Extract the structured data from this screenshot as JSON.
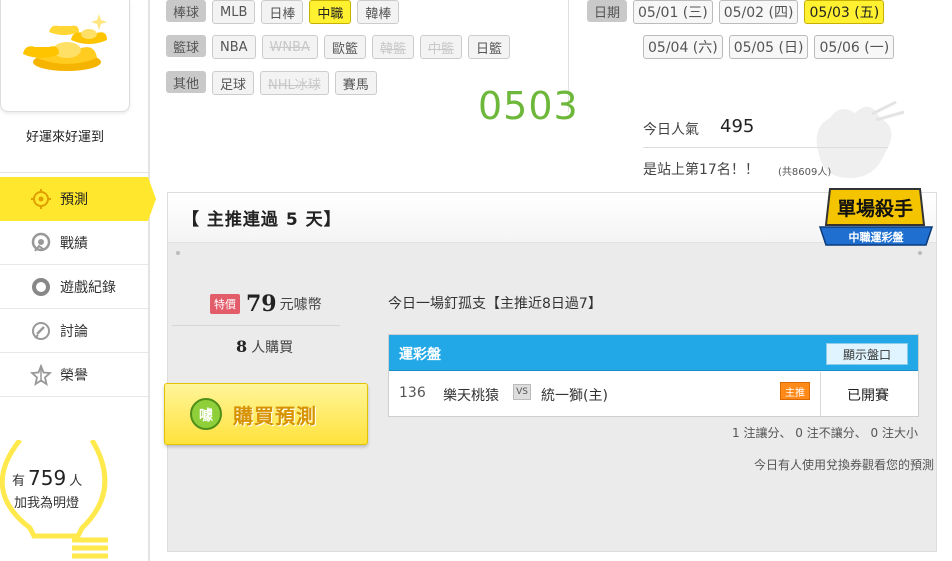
{
  "sidebar": {
    "user_name": "好運來好運到",
    "nav": [
      {
        "label": "預測",
        "icon": "target-icon",
        "active": true
      },
      {
        "label": "戰績",
        "icon": "chart-badge-icon",
        "active": false
      },
      {
        "label": "遊戲紀錄",
        "icon": "ring-icon",
        "active": false
      },
      {
        "label": "討論",
        "icon": "chat-icon",
        "active": false
      },
      {
        "label": "榮譽",
        "icon": "star-icon",
        "active": false
      }
    ],
    "count_prefix": "有",
    "count_value": "759",
    "count_suffix": "人",
    "count_line2": "加我為明燈"
  },
  "filters": {
    "baseball": {
      "label": "棒球",
      "items": [
        {
          "label": "MLB",
          "state": "normal"
        },
        {
          "label": "日棒",
          "state": "normal"
        },
        {
          "label": "中職",
          "state": "selected"
        },
        {
          "label": "韓棒",
          "state": "normal"
        }
      ]
    },
    "basketball": {
      "label": "籃球",
      "items": [
        {
          "label": "NBA",
          "state": "normal"
        },
        {
          "label": "WNBA",
          "state": "disabled"
        },
        {
          "label": "歐籃",
          "state": "normal"
        },
        {
          "label": "韓籃",
          "state": "disabled"
        },
        {
          "label": "中籃",
          "state": "disabled"
        },
        {
          "label": "日籃",
          "state": "normal"
        }
      ]
    },
    "other": {
      "label": "其他",
      "items": [
        {
          "label": "足球",
          "state": "normal"
        },
        {
          "label": "NHL冰球",
          "state": "disabled"
        },
        {
          "label": "賽馬",
          "state": "normal"
        }
      ]
    }
  },
  "dates": {
    "label": "日期",
    "row1": [
      {
        "label": "05/01 (三)",
        "selected": false
      },
      {
        "label": "05/02 (四)",
        "selected": false
      },
      {
        "label": "05/03 (五)",
        "selected": true
      }
    ],
    "row2": [
      {
        "label": "05/04 (六)",
        "selected": false
      },
      {
        "label": "05/05 (日)",
        "selected": false
      },
      {
        "label": "05/06 (一)",
        "selected": false
      }
    ]
  },
  "big_date": "0503",
  "stats": {
    "popularity_label": "今日人氣",
    "popularity_value": "495",
    "rank_text": "是站上第17名！！",
    "rank_sub": "(共8609人)"
  },
  "panel": {
    "title": "【 主推連過 5 天】",
    "badge_main": "單場殺手",
    "badge_sub": "中職運彩盤",
    "tag": "特價",
    "price": "79",
    "price_unit": "元噱幣",
    "buyers_count": "8",
    "buyers_label": "人購買",
    "buy_label": "購買預測",
    "coin_text": "噱",
    "description": "今日一場釘孤支【主推近8日過7】",
    "pick": {
      "title": "運彩盤",
      "show_odds": "顯示盤口",
      "game_no": "136",
      "away": "樂天桃猿",
      "vs": "VS",
      "home": "統一獅(主)",
      "main_tag": "主推",
      "status": "已開賽"
    },
    "summary": "1 注讓分、 0 注不讓分、 0 注大小",
    "voucher_note": "今日有人使用兌換券觀看您的預測"
  }
}
